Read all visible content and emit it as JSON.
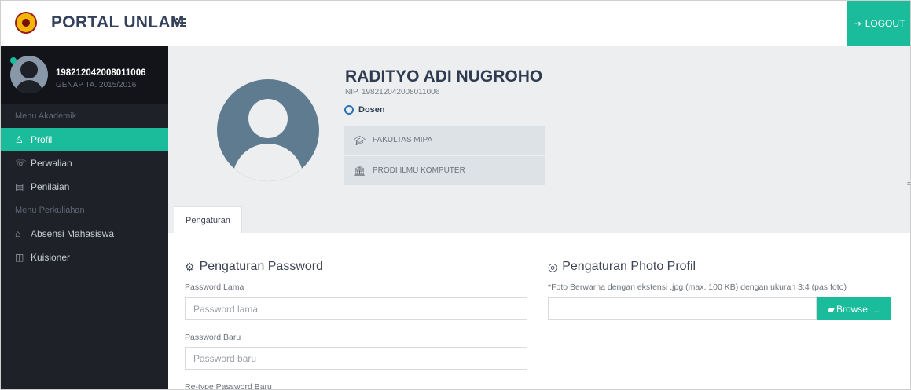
{
  "header": {
    "brand": "PORTAL UNLAM",
    "logout_label": "LOGOUT",
    "apps_icon": "grid-icon",
    "logout_icon": "sign-out-icon"
  },
  "sidebar": {
    "user_id": "198212042008011006",
    "term": "GENAP TA. 2015/2016",
    "sections": [
      {
        "title": "Menu Akademik",
        "items": [
          {
            "label": "Profil",
            "icon": "user-icon",
            "active": true
          },
          {
            "label": "Perwalian",
            "icon": "chat-icon",
            "active": false
          },
          {
            "label": "Penilaian",
            "icon": "document-icon",
            "active": false
          }
        ]
      },
      {
        "title": "Menu Perkuliahan",
        "items": [
          {
            "label": "Absensi Mahasiswa",
            "icon": "building-icon",
            "active": false
          },
          {
            "label": "Kuisioner",
            "icon": "clipboard-icon",
            "active": false
          }
        ]
      }
    ]
  },
  "profile": {
    "name": "RADITYO ADI NUGROHO",
    "nip": "NIP. 198212042008011006",
    "role": "Dosen",
    "faculty": "FAKULTAS MIPA",
    "program": "PRODI ILMU KOMPUTER"
  },
  "tabs": [
    {
      "label": "Pengaturan",
      "active": true
    }
  ],
  "password_settings": {
    "title": "Pengaturan Password",
    "old_label": "Password Lama",
    "old_placeholder": "Password lama",
    "new_label": "Password Baru",
    "new_placeholder": "Password baru",
    "retype_label": "Re-type Password Baru"
  },
  "photo_settings": {
    "title": "Pengaturan Photo Profil",
    "note": "*Foto Berwarna dengan ekstensi .jpg (max. 100 KB) dengan ukuran 3:4 (pas foto)",
    "browse_label": "Browse …"
  },
  "colors": {
    "accent": "#1abc9c",
    "sidebar_bg": "#1e2128",
    "banner_bg": "#eceeef"
  }
}
